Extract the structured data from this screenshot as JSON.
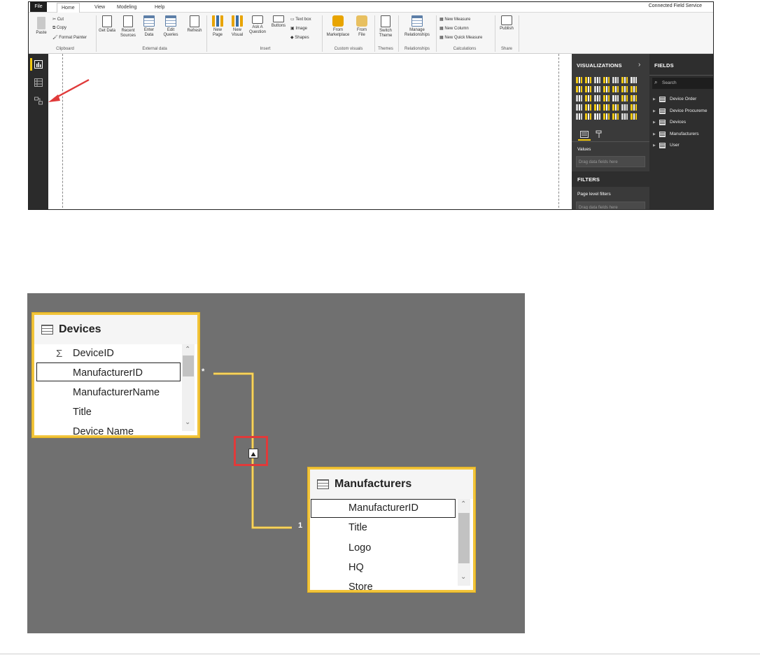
{
  "window": {
    "tabs": [
      "File",
      "Home",
      "View",
      "Modeling",
      "Help"
    ],
    "title": "Connected Field Service"
  },
  "ribbon": {
    "clipboard": {
      "paste": "Paste",
      "cut": "Cut",
      "copy": "Copy",
      "format_painter": "Format Painter",
      "group": "Clipboard"
    },
    "external_data": {
      "get_data": "Get Data",
      "recent_sources": "Recent Sources",
      "enter_data": "Enter Data",
      "edit_queries": "Edit Queries",
      "refresh": "Refresh",
      "group": "External data"
    },
    "insert": {
      "new_page": "New Page",
      "new_visual": "New Visual",
      "ask_question": "Ask A Question",
      "buttons": "Buttons",
      "text_box": "Text box",
      "image": "Image",
      "shapes": "Shapes",
      "group": "Insert"
    },
    "custom_visuals": {
      "from_marketplace": "From Marketplace",
      "from_file": "From File",
      "group": "Custom visuals"
    },
    "themes": {
      "switch_theme": "Switch Theme",
      "group": "Themes"
    },
    "relationships": {
      "manage": "Manage Relationships",
      "group": "Relationships"
    },
    "calculations": {
      "new_measure": "New Measure",
      "new_column": "New Column",
      "new_quick_measure": "New Quick Measure",
      "group": "Calculations"
    },
    "share": {
      "publish": "Publish",
      "group": "Share"
    }
  },
  "panes": {
    "visualizations": "VISUALIZATIONS",
    "fields": "FIELDS",
    "search_placeholder": "Search",
    "values_label": "Values",
    "drag_fields": "Drag data fields here",
    "filters": "FILTERS",
    "page_level_filters": "Page level filters",
    "drag_fields_2": "Drag data fields here",
    "field_tables": [
      "Device Order",
      "Device Procureme",
      "Devices",
      "Manufacturers",
      "User"
    ]
  },
  "diagram": {
    "devices": {
      "title": "Devices",
      "fields": [
        "DeviceID",
        "ManufacturerID",
        "ManufacturerName",
        "Title",
        "Device Name"
      ]
    },
    "manufacturers": {
      "title": "Manufacturers",
      "fields": [
        "ManufacturerID",
        "Title",
        "Logo",
        "HQ",
        "Store"
      ]
    },
    "cardinality_many": "*",
    "cardinality_one": "1"
  },
  "colors": {
    "highlight_border": "#f2c43a",
    "annotation_red": "#e03a3a",
    "diagram_bg": "#707070",
    "pane_dark": "#3a3a3a"
  }
}
